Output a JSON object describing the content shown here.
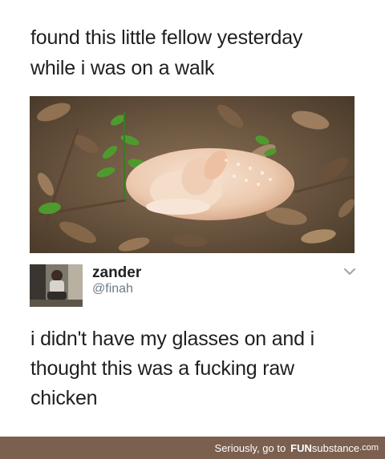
{
  "post": {
    "caption_line1": "found this little fellow yesterday",
    "caption_line2": "while i was on a walk"
  },
  "tweet": {
    "display_name": "zander",
    "handle": "@finah",
    "text_line1": "i didn't have my glasses on and i",
    "text_line2": "thought this was a fucking raw",
    "text_line3": "chicken"
  },
  "footer": {
    "prefix": "Seriously, go to",
    "brand_fun": "FUN",
    "brand_sub": "substance",
    "brand_tld": ".com"
  },
  "icons": {
    "chevron": "chevron-down-icon"
  },
  "colors": {
    "footer_bg": "#7b5f4f",
    "handle": "#6b7b88",
    "text": "#1f1f1f"
  }
}
